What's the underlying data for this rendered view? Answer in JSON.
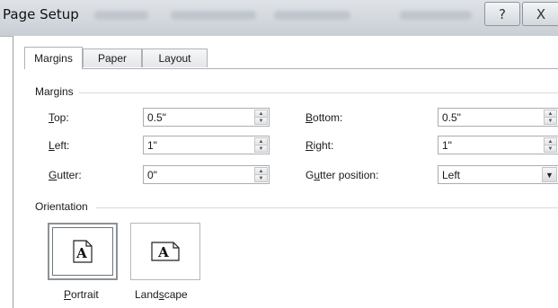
{
  "window": {
    "title": "Page Setup",
    "help_glyph": "?",
    "close_glyph": "X"
  },
  "tabs": [
    {
      "label": "Margins",
      "selected": true
    },
    {
      "label": "Paper",
      "selected": false
    },
    {
      "label": "Layout",
      "selected": false
    }
  ],
  "margins": {
    "group_label": "Margins",
    "top": {
      "label_key": "T",
      "label_rest": "op:",
      "value": "0.5\""
    },
    "bottom": {
      "label_key": "B",
      "label_rest": "ottom:",
      "value": "0.5\""
    },
    "left": {
      "label_key": "L",
      "label_rest": "eft:",
      "value": "1\""
    },
    "right": {
      "label_key": "R",
      "label_rest": "ight:",
      "value": "1\""
    },
    "gutter": {
      "label_key": "G",
      "label_rest": "utter:",
      "value": "0\""
    },
    "gutter_position": {
      "label_pre": "G",
      "label_key": "u",
      "label_rest": "tter position:",
      "value": "Left"
    }
  },
  "orientation": {
    "group_label": "Orientation",
    "portrait": {
      "label_key": "P",
      "label_rest": "ortrait",
      "glyph": "A",
      "selected": true
    },
    "landscape": {
      "label_pre": "Land",
      "label_key": "s",
      "label_rest": "cape",
      "glyph": "A",
      "selected": false
    }
  }
}
